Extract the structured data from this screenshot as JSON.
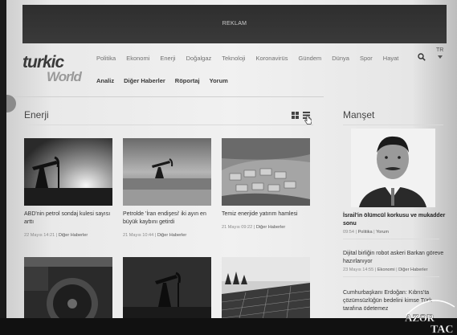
{
  "ad": {
    "label": "REKLAM"
  },
  "logo": {
    "part1": "turkic",
    "part2": "World"
  },
  "nav": {
    "primary": [
      "Politika",
      "Ekonomi",
      "Enerji",
      "Doğalgaz",
      "Teknoloji",
      "Koronavirüs",
      "Gündem",
      "Dünya",
      "Spor",
      "Hayat"
    ],
    "secondary": [
      "Analiz",
      "Diğer Haberler",
      "Röportaj",
      "Yorum"
    ],
    "lang": "TR"
  },
  "section": {
    "title": "Enerji"
  },
  "cards": [
    {
      "caption": "ABD'nin petrol sondaj kulesi sayısı arttı",
      "date": "22 Mayıs 14:21",
      "category": "Diğer Haberler",
      "image": "oil-pump-sunset"
    },
    {
      "caption": "Petrolde 'İran endişesi' iki ayın en büyük kaybını getirdi",
      "date": "21 Mayıs 10:44",
      "category": "Diğer Haberler",
      "image": "oil-pump-field"
    },
    {
      "caption": "Temiz enerjide yatırım hamlesi",
      "date": "21 Mayıs 09:22",
      "category": "Diğer Haberler",
      "image": "aerial-solar-site"
    },
    {
      "caption": "",
      "date": "",
      "category": "",
      "image": "turbine-engine"
    },
    {
      "caption": "",
      "date": "",
      "category": "",
      "image": "oil-pump-dusk"
    },
    {
      "caption": "",
      "date": "",
      "category": "",
      "image": "solar-panels"
    }
  ],
  "manset": {
    "title": "Manşet",
    "items": [
      {
        "title": "İsrail'in ölümcül korkusu ve mukadder sonu",
        "date": "09:54",
        "cat1": "Politika",
        "cat2": "Yorum"
      },
      {
        "title": "Dijital birliğin robot askeri Barkan göreve hazırlanıyor",
        "date": "23 Mayıs 14:55",
        "cat1": "Ekonomi",
        "cat2": "Diğer Haberler"
      },
      {
        "title": "Cumhurbaşkanı Erdoğan: Kıbrıs'ta çözümsüzlüğün bedelini kimse Türk tarafına ödetemez",
        "date": "",
        "cat1": "",
        "cat2": ""
      }
    ]
  },
  "watermark": {
    "line1": "AZƏR",
    "line2": "TAC"
  }
}
